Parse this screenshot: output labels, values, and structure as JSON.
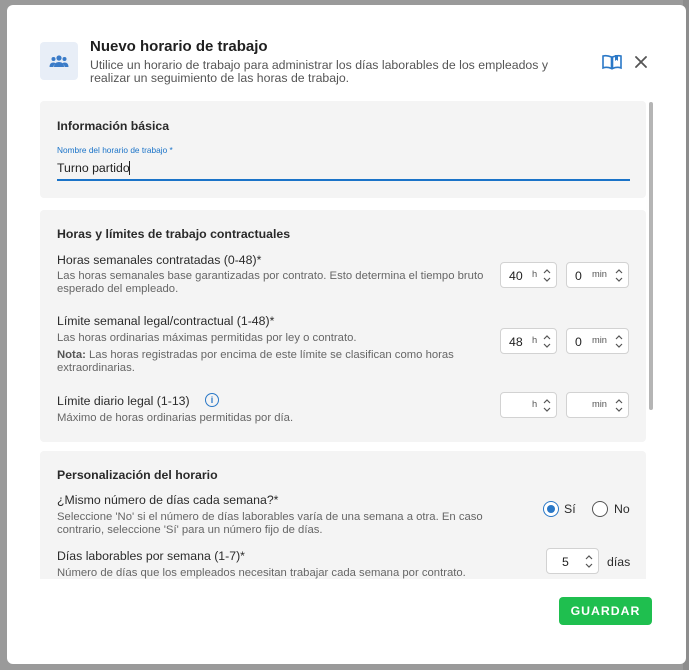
{
  "header": {
    "title": "Nuevo horario de trabajo",
    "subtitle": "Utilice un horario de trabajo para administrar los días laborables de los empleados y realizar un seguimiento de las horas de trabajo."
  },
  "basic_info": {
    "title": "Información básica",
    "name_label": "Nombre del horario de trabajo *",
    "name_value": "Turno partido"
  },
  "hours": {
    "title": "Horas y límites de trabajo contractuales",
    "weekly": {
      "label": "Horas semanales contratadas (0-48)*",
      "description": "Las horas semanales base garantizadas por contrato. Esto determina el tiempo bruto esperado del empleado.",
      "hours_value": "40",
      "minutes_value": "0"
    },
    "weekly_limit": {
      "label": "Límite semanal legal/contractual (1-48)*",
      "description": "Las horas ordinarias máximas permitidas por ley o contrato.",
      "note_label": "Nota:",
      "note_text": " Las horas registradas por encima de este límite se clasifican como horas extraordinarias.",
      "hours_value": "48",
      "minutes_value": "0"
    },
    "daily_limit": {
      "label": "Límite diario legal (1-13)",
      "description": "Máximo de horas ordinarias permitidas por día.",
      "hours_value": "",
      "minutes_value": ""
    },
    "unit_h": "h",
    "unit_min": "min"
  },
  "personalization": {
    "title": "Personalización del horario",
    "same_days": {
      "label": "¿Mismo número de días cada semana?*",
      "description": "Seleccione 'No' si el número de días laborables varía de una semana a otra. En caso contrario, seleccione 'Sí' para un número fijo de días.",
      "yes_label": "Sí",
      "no_label": "No",
      "selected": "Sí"
    },
    "days_per_week": {
      "label": "Días laborables por semana (1-7)*",
      "description": "Número de días que los empleados necesitan trabajar cada semana por contrato.",
      "value": "5",
      "unit": "días"
    }
  },
  "footer": {
    "save_label": "GUARDAR"
  },
  "colors": {
    "accent": "#1a73c8",
    "save": "#1fbf4f"
  }
}
